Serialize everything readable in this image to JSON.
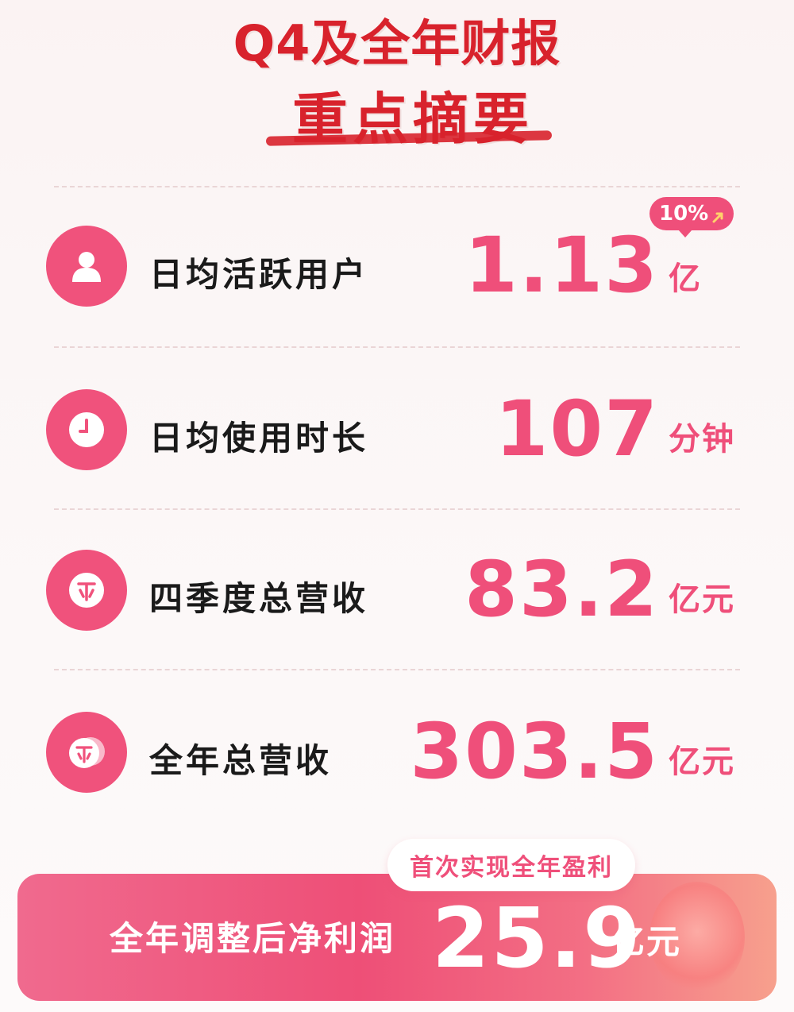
{
  "header": {
    "title_line1": "Q4及全年财报",
    "title_line2": "重点摘要"
  },
  "metrics": [
    {
      "label": "日均活跃用户",
      "value": "1.13",
      "unit": "亿",
      "icon": "user-icon",
      "badge": "10%",
      "badge_icon": "arrow-up-icon"
    },
    {
      "label": "日均使用时长",
      "value": "107",
      "unit": "分钟",
      "icon": "clock-icon"
    },
    {
      "label": "四季度总营收",
      "value": "83.2",
      "unit": "亿元",
      "icon": "coin-icon"
    },
    {
      "label": "全年总营收",
      "value": "303.5",
      "unit": "亿元",
      "icon": "coins-icon"
    }
  ],
  "highlight": {
    "tag": "首次实现全年盈利",
    "label": "全年调整后净利润",
    "value": "25.9",
    "unit": "亿元"
  },
  "colors": {
    "title_red": "#d8222c",
    "accent_pink": "#ef4f7a",
    "label_text": "#1a1a1a"
  }
}
